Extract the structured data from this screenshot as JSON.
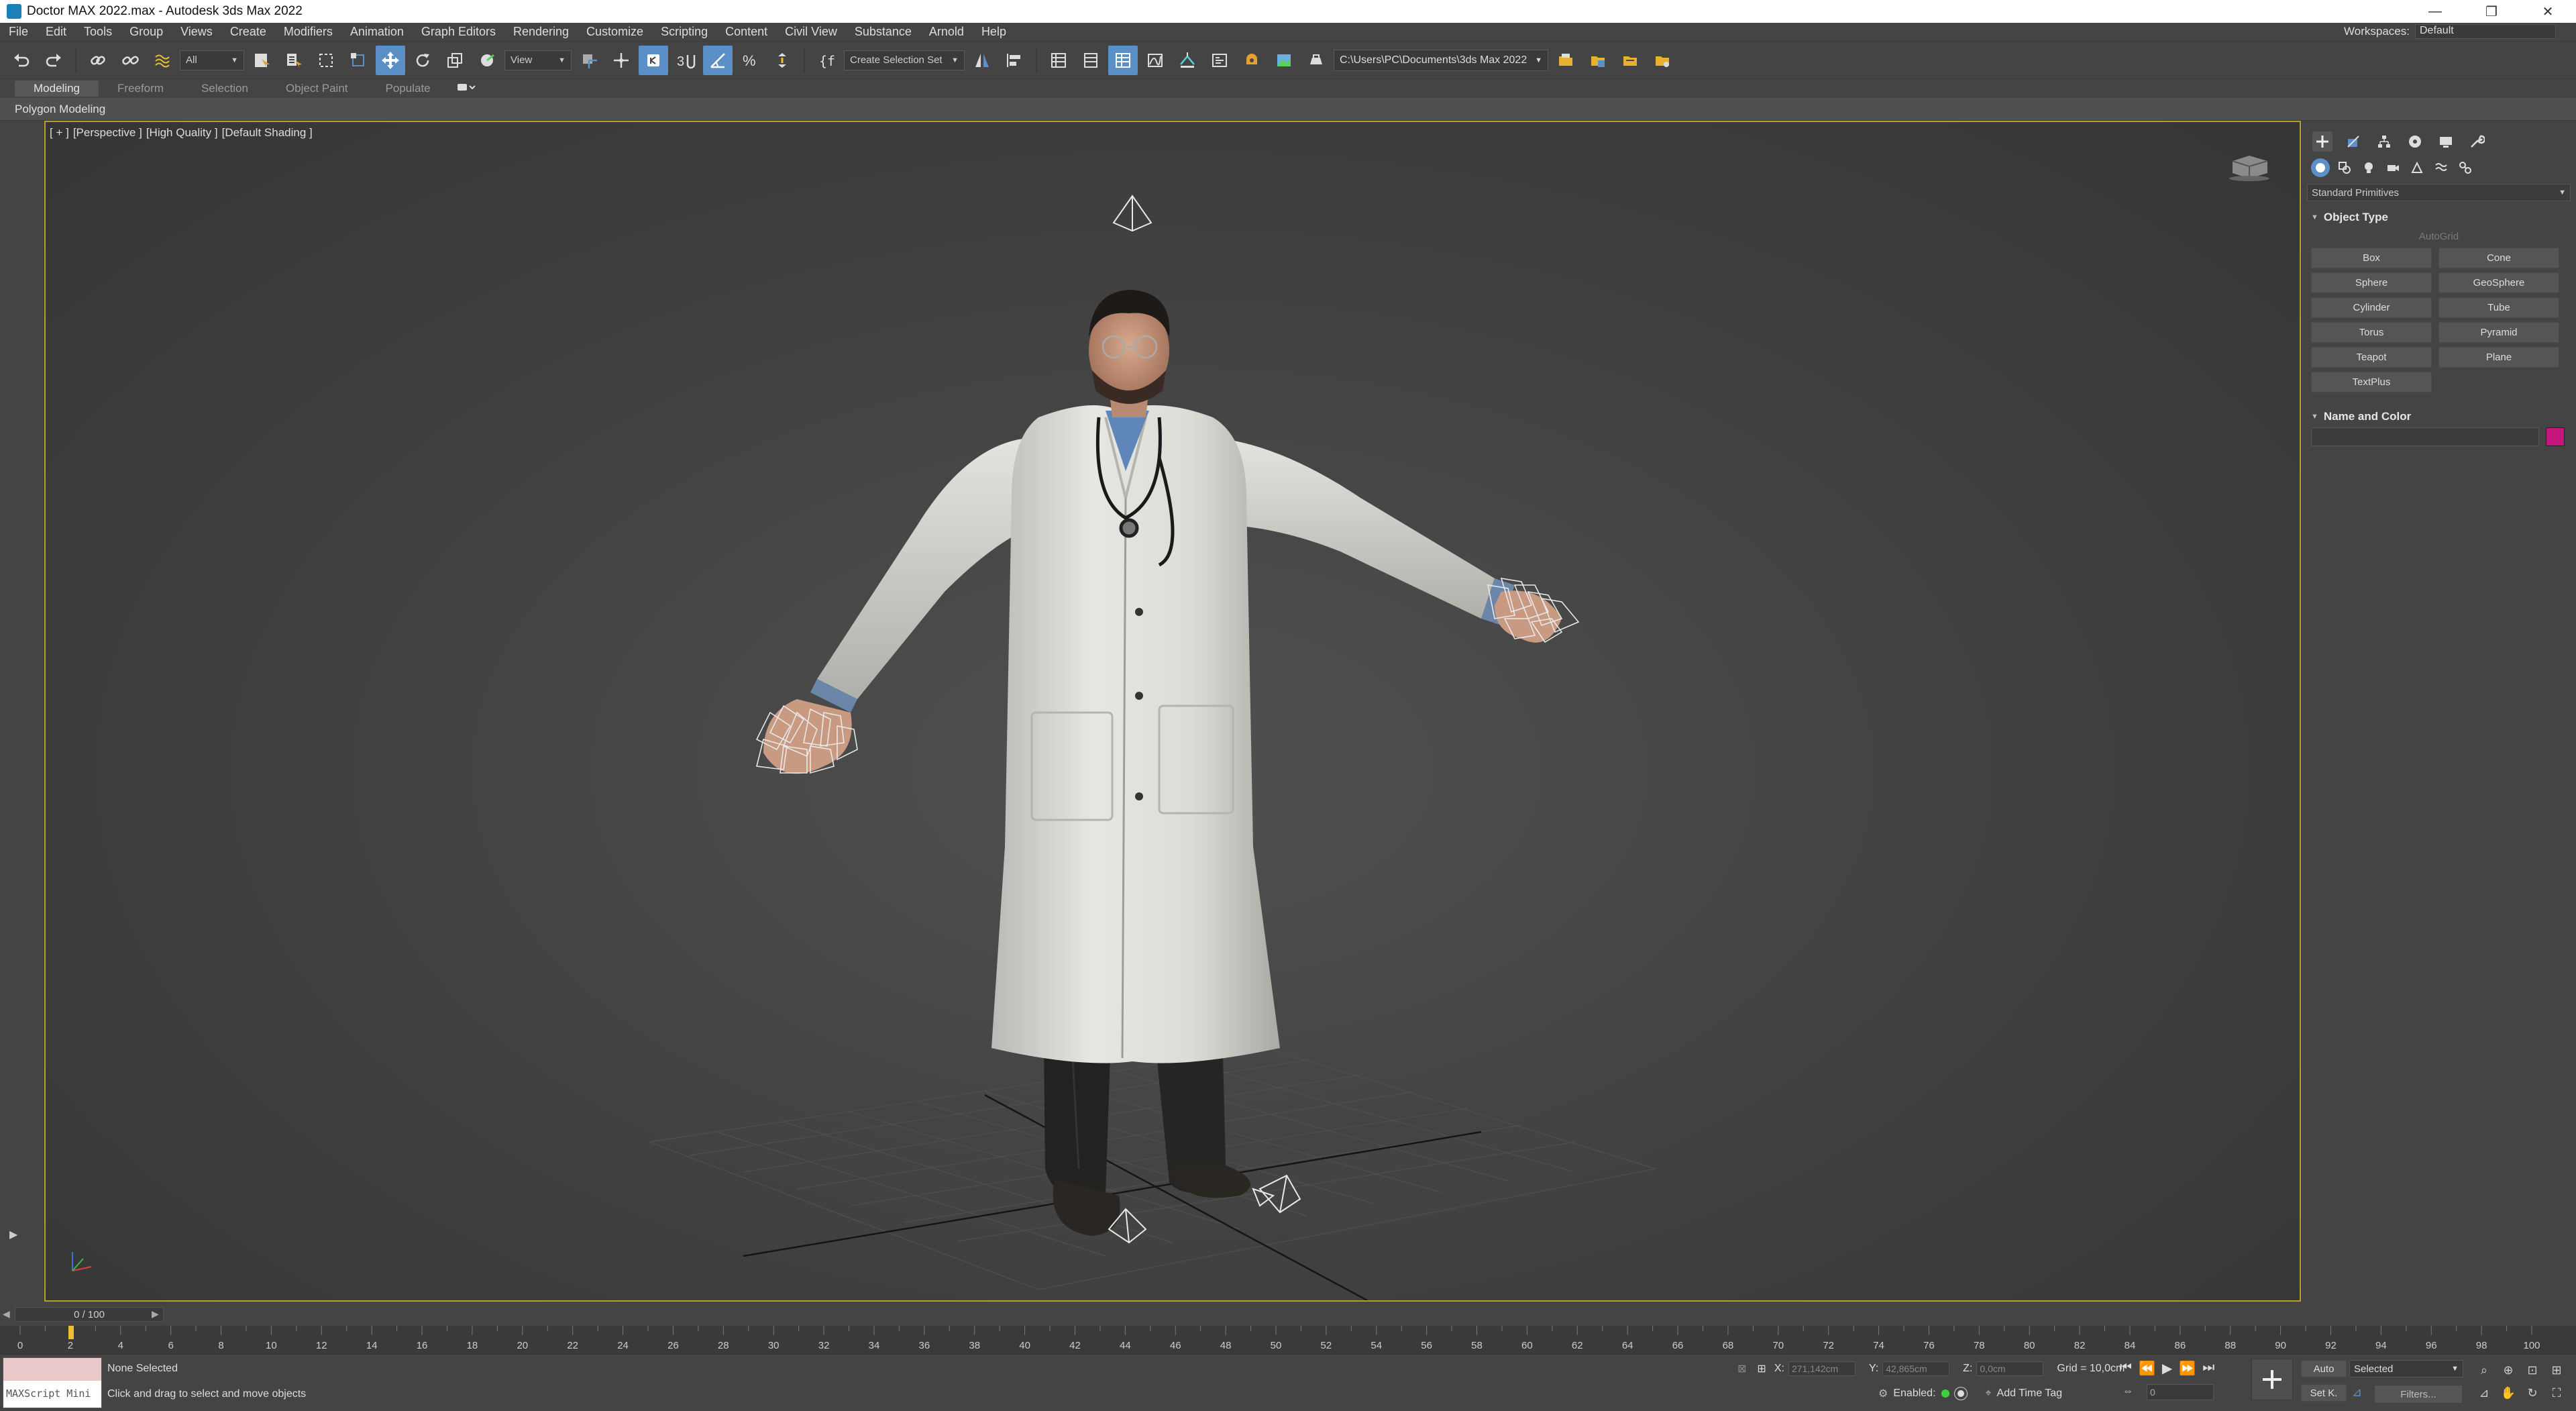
{
  "window": {
    "title": "Doctor MAX 2022.max - Autodesk 3ds Max 2022",
    "minimize_glyph": "—",
    "restore_glyph": "❐",
    "close_glyph": "✕"
  },
  "menu": {
    "items": [
      "File",
      "Edit",
      "Tools",
      "Group",
      "Views",
      "Create",
      "Modifiers",
      "Animation",
      "Graph Editors",
      "Rendering",
      "Customize",
      "Scripting",
      "Content",
      "Civil View",
      "Substance",
      "Arnold",
      "Help"
    ],
    "workspaces_label": "Workspaces:",
    "workspaces_value": "Default"
  },
  "toolbar": {
    "selection_filter": "All",
    "reference_coord": "View",
    "named_selection_set": "Create Selection Set",
    "project_path": "C:\\Users\\PC\\Documents\\3ds Max 2022"
  },
  "ribbon": {
    "tabs": [
      "Modeling",
      "Freeform",
      "Selection",
      "Object Paint",
      "Populate"
    ],
    "active_tab": "Modeling",
    "panel_label": "Polygon Modeling"
  },
  "viewport": {
    "labels": [
      "[ + ]",
      "[Perspective ]",
      "[High Quality ]",
      "[Default Shading ]"
    ],
    "border_color": "#b89e2e"
  },
  "command_panel": {
    "category_dropdown": "Standard Primitives",
    "object_type_title": "Object Type",
    "autogrid_label": "AutoGrid",
    "primitives": [
      "Box",
      "Cone",
      "Sphere",
      "GeoSphere",
      "Cylinder",
      "Tube",
      "Torus",
      "Pyramid",
      "Teapot",
      "Plane",
      "TextPlus"
    ],
    "name_color_title": "Name and Color",
    "object_color": "#c6157c"
  },
  "timeline": {
    "current_frame_label": "0 / 100",
    "ticks": [
      "0",
      "2",
      "4",
      "6",
      "8",
      "10",
      "12",
      "14",
      "16",
      "18",
      "20",
      "22",
      "24",
      "26",
      "28",
      "30",
      "32",
      "34",
      "36",
      "38",
      "40",
      "42",
      "44",
      "46",
      "48",
      "50",
      "52",
      "54",
      "56",
      "58",
      "60",
      "62",
      "64",
      "66",
      "68",
      "70",
      "72",
      "74",
      "76",
      "78",
      "80",
      "82",
      "84",
      "86",
      "88",
      "90",
      "92",
      "94",
      "96",
      "98",
      "100"
    ]
  },
  "status": {
    "maxscript_label": "MAXScript Mini",
    "selection_status": "None Selected",
    "prompt": "Click and drag to select and move objects",
    "x_label": "X:",
    "x_value": "271,142cm",
    "y_label": "Y:",
    "y_value": "42,865cm",
    "z_label": "Z:",
    "z_value": "0,0cm",
    "grid_text": "Grid = 10,0cm",
    "enabled_label": "Enabled:",
    "add_time_tag": "Add Time Tag",
    "frame_value": "0",
    "auto_key": "Auto",
    "set_key": "Set K.",
    "key_filter": "Selected",
    "filters": "Filters..."
  }
}
